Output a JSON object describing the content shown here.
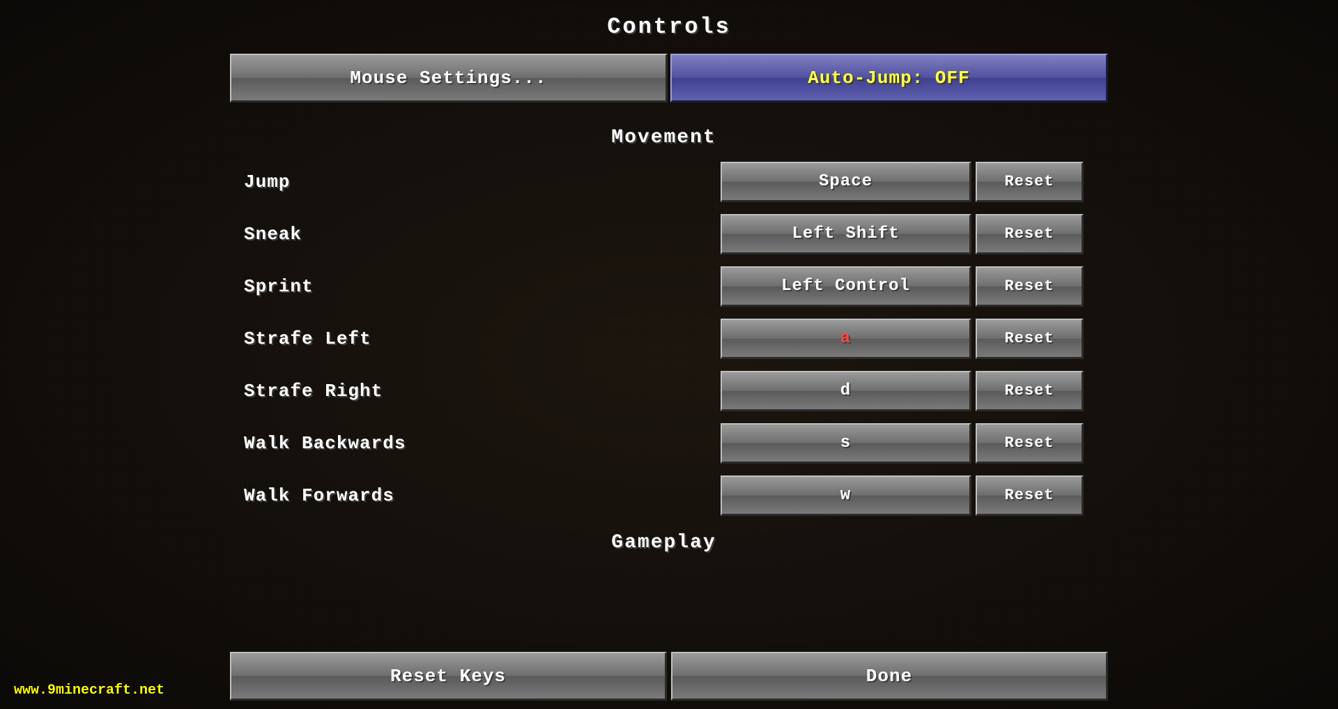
{
  "page": {
    "title": "Controls",
    "background_color": "#1a1a1a"
  },
  "top_buttons": {
    "mouse_settings_label": "Mouse Settings...",
    "auto_jump_label": "Auto-Jump: OFF"
  },
  "sections": [
    {
      "id": "movement",
      "header": "Movement",
      "bindings": [
        {
          "action": "Jump",
          "key": "Space",
          "conflict": false
        },
        {
          "action": "Sneak",
          "key": "Left Shift",
          "conflict": false
        },
        {
          "action": "Sprint",
          "key": "Left Control",
          "conflict": false
        },
        {
          "action": "Strafe Left",
          "key": "a",
          "conflict": true
        },
        {
          "action": "Strafe Right",
          "key": "d",
          "conflict": false
        },
        {
          "action": "Walk Backwards",
          "key": "s",
          "conflict": false
        },
        {
          "action": "Walk Forwards",
          "key": "w",
          "conflict": false
        }
      ]
    },
    {
      "id": "gameplay",
      "header": "Gameplay",
      "bindings": []
    }
  ],
  "reset_button_label": "Reset",
  "bottom_buttons": {
    "reset_keys_label": "Reset Keys",
    "done_label": "Done"
  },
  "watermark": {
    "prefix": "www.",
    "brand": "9minecraft",
    "suffix": ".net"
  }
}
